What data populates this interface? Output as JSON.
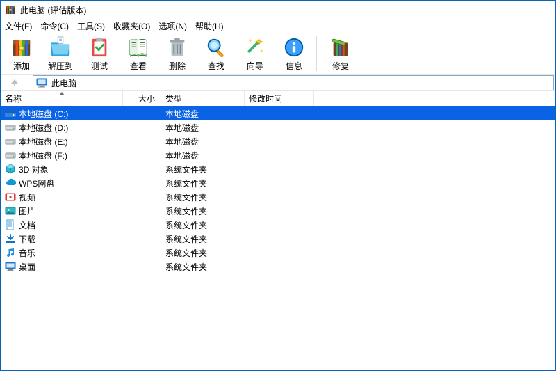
{
  "title": "此电脑 (评估版本)",
  "menus": [
    "文件(F)",
    "命令(C)",
    "工具(S)",
    "收藏夹(O)",
    "选项(N)",
    "帮助(H)"
  ],
  "toolbar": {
    "add": "添加",
    "extract": "解压到",
    "test": "测试",
    "view": "查看",
    "delete": "删除",
    "find": "查找",
    "wizard": "向导",
    "info": "信息",
    "repair": "修复"
  },
  "address": {
    "location": "此电脑"
  },
  "columns": {
    "name": "名称",
    "size": "大小",
    "type": "类型",
    "modified": "修改时间"
  },
  "rows": [
    {
      "icon": "drive-blue",
      "name": "本地磁盘 (C:)",
      "type": "本地磁盘",
      "selected": true
    },
    {
      "icon": "drive",
      "name": "本地磁盘 (D:)",
      "type": "本地磁盘"
    },
    {
      "icon": "drive",
      "name": "本地磁盘 (E:)",
      "type": "本地磁盘"
    },
    {
      "icon": "drive",
      "name": "本地磁盘 (F:)",
      "type": "本地磁盘"
    },
    {
      "icon": "cube",
      "name": "3D 对象",
      "type": "系统文件夹"
    },
    {
      "icon": "cloud",
      "name": "WPS网盘",
      "type": "系统文件夹"
    },
    {
      "icon": "video",
      "name": "视频",
      "type": "系统文件夹"
    },
    {
      "icon": "pictures",
      "name": "图片",
      "type": "系统文件夹"
    },
    {
      "icon": "docs",
      "name": "文档",
      "type": "系统文件夹"
    },
    {
      "icon": "download",
      "name": "下载",
      "type": "系统文件夹"
    },
    {
      "icon": "music",
      "name": "音乐",
      "type": "系统文件夹"
    },
    {
      "icon": "desktop",
      "name": "桌面",
      "type": "系统文件夹"
    }
  ]
}
